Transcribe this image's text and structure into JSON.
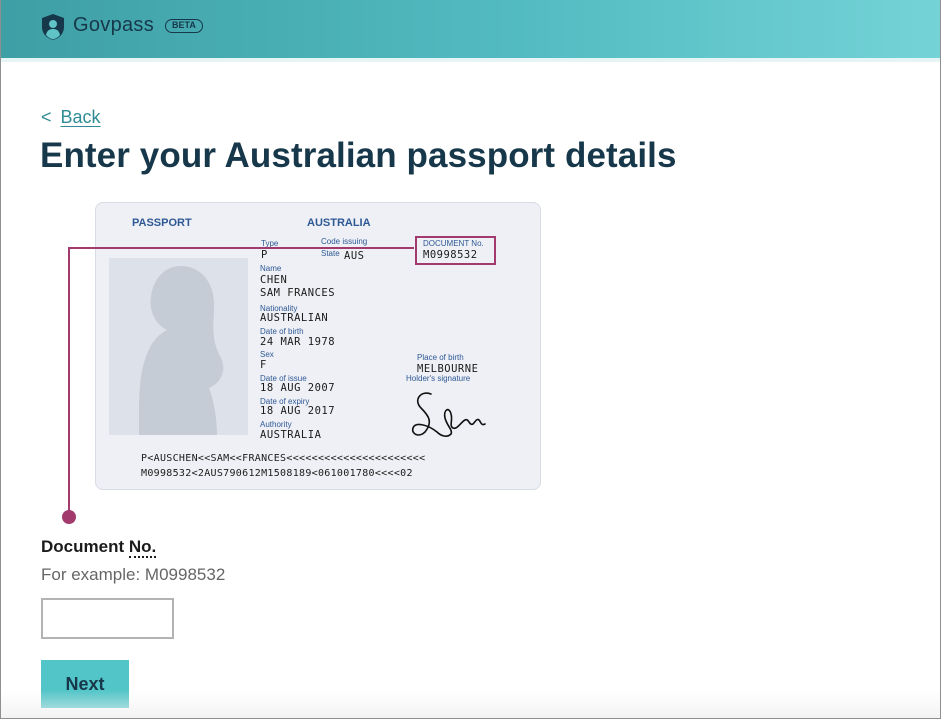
{
  "header": {
    "brand": "Govpass",
    "badge": "BETA",
    "logo_icon": "shield-person-icon",
    "colors": {
      "gradient_start": "#3e9fa5",
      "gradient_end": "#74d3d7",
      "brand_text": "#17384a"
    }
  },
  "nav": {
    "back_chevron": "<",
    "back_label": "Back"
  },
  "page": {
    "title": "Enter your Australian passport details"
  },
  "passport": {
    "heading_left": "PASSPORT",
    "heading_right": "AUSTRALIA",
    "type_label": "Type",
    "type_value": "P",
    "code_label": "Code issuing",
    "state_label": "State",
    "state_value": "AUS",
    "doc_label": "DOCUMENT No.",
    "doc_value": "M0998532",
    "name_label": "Name",
    "surname": "CHEN",
    "given_names": "SAM FRANCES",
    "nationality_label": "Nationality",
    "nationality_value": "AUSTRALIAN",
    "dob_label": "Date of birth",
    "dob_value": "24 MAR 1978",
    "sex_label": "Sex",
    "sex_value": "F",
    "pob_label": "Place of birth",
    "pob_value": "MELBOURNE",
    "signature_label": "Holder's signature",
    "doi_label": "Date of issue",
    "doi_value": "18 AUG 2007",
    "doe_label": "Date of expiry",
    "doe_value": "18 AUG 2017",
    "authority_label": "Authority",
    "authority_value": "AUSTRALIA",
    "mrz_line1": "P<AUSCHEN<<SAM<<FRANCES<<<<<<<<<<<<<<<<<<<<<<",
    "mrz_line2": "M0998532<2AUS790612M1508189<061001780<<<<02",
    "highlight_color": "#a23a6e"
  },
  "form": {
    "field_label": "Document ",
    "field_abbr": "No.",
    "hint": "For example: M0998532",
    "input_value": "",
    "submit_label": "Next",
    "button_color": "#52c5c8"
  }
}
